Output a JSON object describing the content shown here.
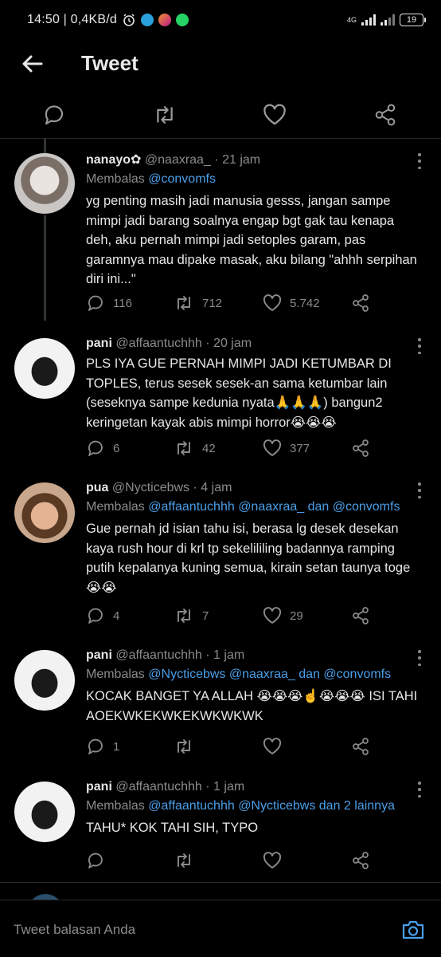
{
  "status_bar": {
    "time_speed": "14:50 | 0,4KB/d",
    "network": "4G",
    "battery": "19"
  },
  "header": {
    "title": "Tweet"
  },
  "main_actions": [
    "reply-icon",
    "retweet-icon",
    "like-icon",
    "share-icon"
  ],
  "tweets": [
    {
      "name": "nanayo✿",
      "handle": "@naaxraa_",
      "time": "· 21 jam",
      "reply_prefix": "Membalas",
      "reply_to": "@convomfs",
      "text": "yg penting masih jadi manusia gesss, jangan sampe mimpi jadi barang soalnya engap bgt gak tau kenapa deh, aku pernah mimpi jadi setoples garam, pas garamnya mau dipake masak, aku bilang \"ahhh serpihan diri ini...\"",
      "replies": "116",
      "retweets": "712",
      "likes": "5.742"
    },
    {
      "name": "pani",
      "handle": "@affaantuchhh",
      "time": "· 20 jam",
      "reply_prefix": "",
      "reply_to": "",
      "text": "PLS IYA GUE PERNAH MIMPI JADI KETUMBAR DI TOPLES, terus sesek sesek-an sama ketumbar lain (seseknya sampe kedunia nyata🙏🙏🙏) bangun2 keringetan kayak abis mimpi horror😭😭😭",
      "replies": "6",
      "retweets": "42",
      "likes": "377"
    },
    {
      "name": "pua",
      "handle": "@Nycticebws",
      "time": "· 4 jam",
      "reply_prefix": "Membalas",
      "reply_to": "@affaantuchhh @naaxraa_ dan @convomfs",
      "text": "Gue pernah jd isian tahu isi, berasa lg desek desekan kaya rush hour di krl tp sekelililing badannya ramping putih kepalanya kuning semua, kirain setan taunya toge 😭😭",
      "replies": "4",
      "retweets": "7",
      "likes": "29"
    },
    {
      "name": "pani",
      "handle": "@affaantuchhh",
      "time": "· 1 jam",
      "reply_prefix": "Membalas",
      "reply_to": "@Nycticebws @naaxraa_ dan @convomfs",
      "text": "KOCAK BANGET YA ALLAH 😭😭😭☝️😭😭😭 ISI TAHI AOEKWKEKWKEKWKWKWK",
      "replies": "1",
      "retweets": "",
      "likes": ""
    },
    {
      "name": "pani",
      "handle": "@affaantuchhh",
      "time": "· 1 jam",
      "reply_prefix": "Membalas",
      "reply_to": "@affaantuchhh @Nycticebws dan 2 lainnya",
      "text": "TAHU* KOK TAHI SIH, TYPO",
      "replies": "",
      "retweets": "",
      "likes": ""
    }
  ],
  "reply_bar": {
    "placeholder": "Tweet balasan Anda"
  },
  "colors": {
    "link": "#4a9ee8",
    "text": "#e6e6e6",
    "muted": "#8b8b8b",
    "bg": "#000000"
  }
}
